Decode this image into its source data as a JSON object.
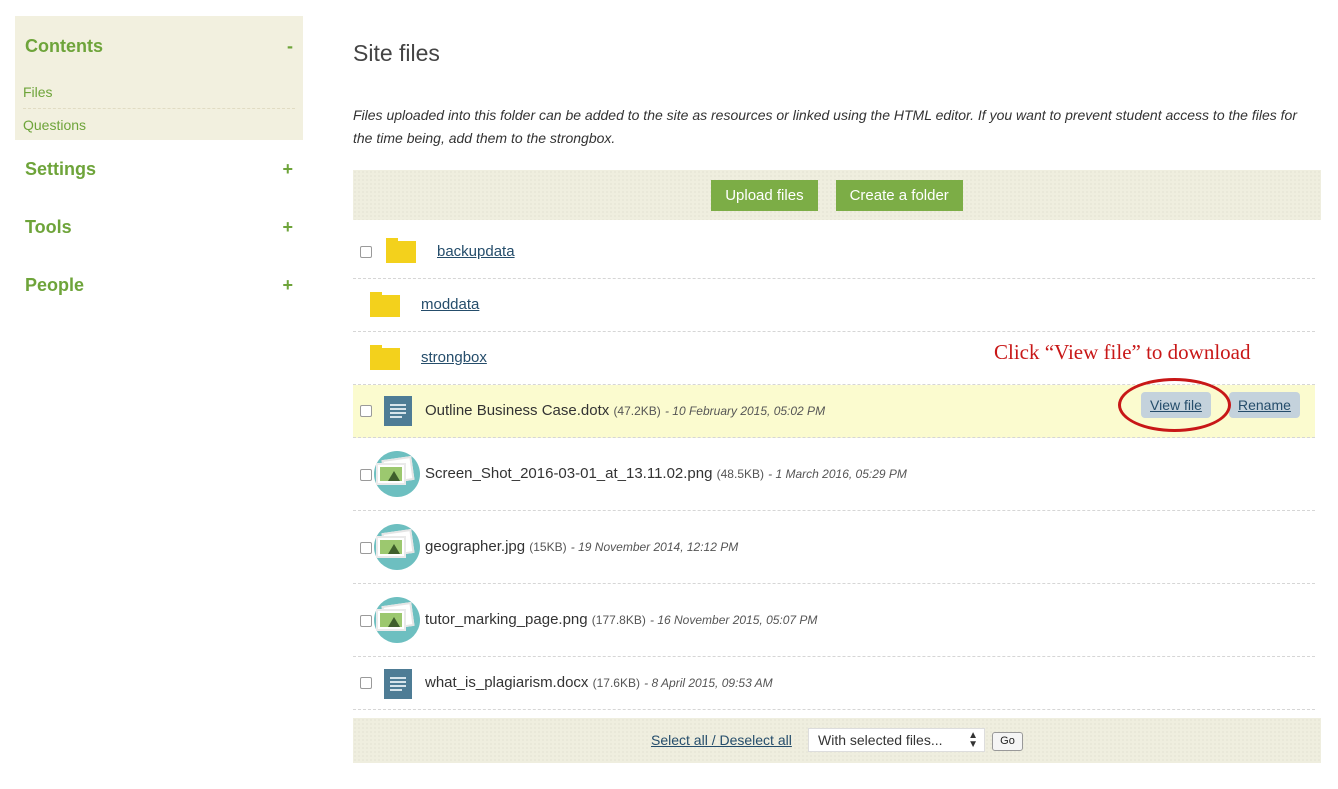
{
  "sidebar": {
    "contents": {
      "title": "Contents",
      "toggle": "-",
      "items": [
        "Files",
        "Questions"
      ]
    },
    "sections": [
      {
        "title": "Settings",
        "toggle": "+"
      },
      {
        "title": "Tools",
        "toggle": "+"
      },
      {
        "title": "People",
        "toggle": "+"
      }
    ]
  },
  "main": {
    "title": "Site files",
    "intro": "Files uploaded into this folder can be added to the site as resources or linked using the HTML editor. If you want to prevent student access to the files for the time being, add them to the strongbox.",
    "toolbar": {
      "upload_label": "Upload files",
      "folder_label": "Create a folder"
    },
    "folders": [
      "backupdata",
      "moddata",
      "strongbox"
    ],
    "files": [
      {
        "name": "Outline Business Case.dotx",
        "size": "(47.2KB)",
        "date": "- 10 February 2015, 05:02 PM",
        "icon": "document-icon"
      },
      {
        "name": "Screen_Shot_2016-03-01_at_13.11.02.png",
        "size": "(48.5KB)",
        "date": "- 1 March 2016, 05:29 PM",
        "icon": "image-icon"
      },
      {
        "name": "geographer.jpg",
        "size": "(15KB)",
        "date": "- 19 November 2014, 12:12 PM",
        "icon": "image-icon"
      },
      {
        "name": "tutor_marking_page.png",
        "size": "(177.8KB)",
        "date": "- 16 November 2015, 05:07 PM",
        "icon": "image-icon"
      },
      {
        "name": "what_is_plagiarism.docx",
        "size": "(17.6KB)",
        "date": "- 8 April 2015, 09:53 AM",
        "icon": "document-icon"
      }
    ],
    "actions": {
      "view": "View file",
      "rename": "Rename"
    },
    "annotation": "Click “View file” to download",
    "footer": {
      "select_all": "Select all / Deselect all",
      "with_selected": "With selected files...",
      "go": "Go"
    }
  },
  "colors": {
    "accent_green": "#7cad46",
    "sidebar_bg": "#f2f0df",
    "highlight_row": "#fbfbcf",
    "link": "#254d6b",
    "annotation_red": "#c81717",
    "folder_yellow": "#f3d11c"
  }
}
